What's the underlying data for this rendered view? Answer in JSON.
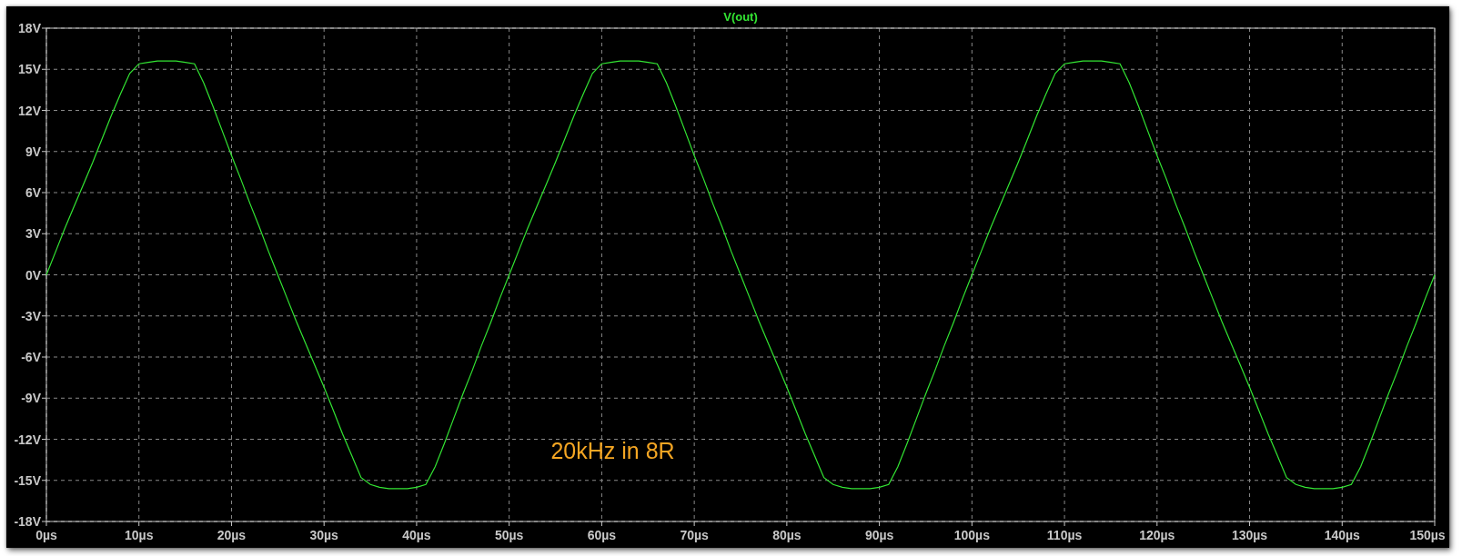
{
  "chart_data": {
    "type": "line",
    "grid": true,
    "xlim": [
      0,
      150
    ],
    "ylim": [
      -18,
      18
    ],
    "xticks": [
      {
        "value": 0,
        "label": "0µs"
      },
      {
        "value": 10,
        "label": "10µs"
      },
      {
        "value": 20,
        "label": "20µs"
      },
      {
        "value": 30,
        "label": "30µs"
      },
      {
        "value": 40,
        "label": "40µs"
      },
      {
        "value": 50,
        "label": "50µs"
      },
      {
        "value": 60,
        "label": "60µs"
      },
      {
        "value": 70,
        "label": "70µs"
      },
      {
        "value": 80,
        "label": "80µs"
      },
      {
        "value": 90,
        "label": "90µs"
      },
      {
        "value": 100,
        "label": "100µs"
      },
      {
        "value": 110,
        "label": "110µs"
      },
      {
        "value": 120,
        "label": "120µs"
      },
      {
        "value": 130,
        "label": "130µs"
      },
      {
        "value": 140,
        "label": "140µs"
      },
      {
        "value": 150,
        "label": "150µs"
      }
    ],
    "yticks": [
      {
        "value": 18,
        "label": "18V"
      },
      {
        "value": 15,
        "label": "15V"
      },
      {
        "value": 12,
        "label": "12V"
      },
      {
        "value": 9,
        "label": "9V"
      },
      {
        "value": 6,
        "label": "6V"
      },
      {
        "value": 3,
        "label": "3V"
      },
      {
        "value": 0,
        "label": "0V"
      },
      {
        "value": -3,
        "label": "-3V"
      },
      {
        "value": -6,
        "label": "-6V"
      },
      {
        "value": -9,
        "label": "-9V"
      },
      {
        "value": -12,
        "label": "-12V"
      },
      {
        "value": -15,
        "label": "-15V"
      },
      {
        "value": -18,
        "label": "-18V"
      }
    ],
    "x": [
      0,
      1,
      2,
      3,
      4,
      5,
      6,
      7,
      8,
      9,
      10,
      11,
      12,
      13,
      14,
      15,
      16,
      17,
      18,
      19,
      20,
      21,
      22,
      23,
      24,
      25,
      26,
      27,
      28,
      29,
      30,
      31,
      32,
      33,
      34,
      35,
      36,
      37,
      38,
      39,
      40,
      41,
      42,
      43,
      44,
      45,
      46,
      47,
      48,
      49,
      50,
      51,
      52,
      53,
      54,
      55,
      56,
      57,
      58,
      59,
      60,
      61,
      62,
      63,
      64,
      65,
      66,
      67,
      68,
      69,
      70,
      71,
      72,
      73,
      74,
      75,
      76,
      77,
      78,
      79,
      80,
      81,
      82,
      83,
      84,
      85,
      86,
      87,
      88,
      89,
      90,
      91,
      92,
      93,
      94,
      95,
      96,
      97,
      98,
      99,
      100,
      101,
      102,
      103,
      104,
      105,
      106,
      107,
      108,
      109,
      110,
      111,
      112,
      113,
      114,
      115,
      116,
      117,
      118,
      119,
      120,
      121,
      122,
      123,
      124,
      125,
      126,
      127,
      128,
      129,
      130,
      131,
      132,
      133,
      134,
      135,
      136,
      137,
      138,
      139,
      140,
      141,
      142,
      143,
      144,
      145,
      146,
      147,
      148,
      149,
      150
    ],
    "series": [
      {
        "name": "V(out)",
        "color": "#33e633",
        "values": [
          0,
          1.7,
          3.4,
          5.0,
          6.6,
          8.2,
          9.9,
          11.6,
          13.2,
          14.7,
          15.4,
          15.5,
          15.6,
          15.6,
          15.6,
          15.5,
          15.4,
          14.0,
          12.3,
          10.5,
          8.7,
          7.0,
          5.2,
          3.5,
          1.7,
          0,
          -1.7,
          -3.4,
          -5.0,
          -6.6,
          -8.2,
          -9.9,
          -11.6,
          -13.2,
          -14.8,
          -15.3,
          -15.5,
          -15.6,
          -15.6,
          -15.6,
          -15.5,
          -15.3,
          -14.0,
          -12.3,
          -10.5,
          -8.7,
          -7.0,
          -5.2,
          -3.5,
          -1.7,
          0,
          1.7,
          3.4,
          5.0,
          6.6,
          8.2,
          9.9,
          11.6,
          13.2,
          14.7,
          15.4,
          15.5,
          15.6,
          15.6,
          15.6,
          15.5,
          15.4,
          14.0,
          12.3,
          10.5,
          8.7,
          7.0,
          5.2,
          3.5,
          1.7,
          0,
          -1.7,
          -3.4,
          -5.0,
          -6.6,
          -8.2,
          -9.9,
          -11.6,
          -13.2,
          -14.8,
          -15.3,
          -15.5,
          -15.6,
          -15.6,
          -15.6,
          -15.5,
          -15.3,
          -14.0,
          -12.3,
          -10.5,
          -8.7,
          -7.0,
          -5.2,
          -3.5,
          -1.7,
          0,
          1.7,
          3.4,
          5.0,
          6.6,
          8.2,
          9.9,
          11.6,
          13.2,
          14.7,
          15.4,
          15.5,
          15.6,
          15.6,
          15.6,
          15.5,
          15.4,
          14.0,
          12.3,
          10.5,
          8.7,
          7.0,
          5.2,
          3.5,
          1.7,
          0,
          -1.7,
          -3.4,
          -5.0,
          -6.6,
          -8.2,
          -9.9,
          -11.6,
          -13.2,
          -14.8,
          -15.3,
          -15.5,
          -15.6,
          -15.6,
          -15.6,
          -15.5,
          -15.3,
          -14.0,
          -12.3,
          -10.5,
          -8.7,
          -7.0,
          -5.2,
          -3.5,
          -1.7,
          0
        ]
      }
    ],
    "annotations": [
      "20kHz in 8R"
    ]
  }
}
